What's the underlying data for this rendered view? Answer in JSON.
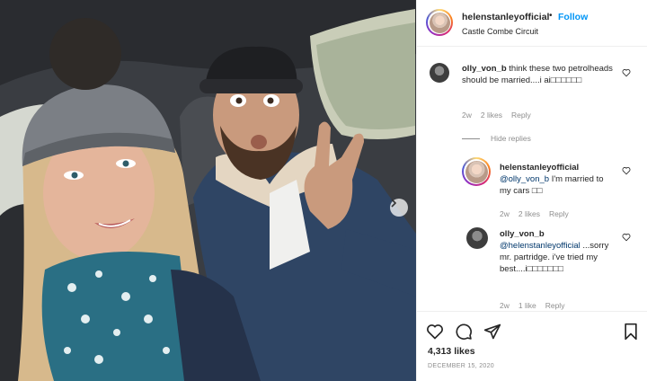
{
  "post": {
    "username": "helenstanleyofficial",
    "separator": "•",
    "follow_label": "Follow",
    "location": "Castle Combe Circuit"
  },
  "comments": [
    {
      "username": "olly_von_b",
      "text": "think these two petrolheads should be married....i ai□□□□□□",
      "time": "2w",
      "likes": "2 likes",
      "reply": "Reply"
    }
  ],
  "hide_replies_label": "Hide replies",
  "replies": [
    {
      "username": "helenstanleyofficial",
      "mention": "@olly_von_b",
      "text": " I'm married to my cars □□",
      "time": "2w",
      "likes": "2 likes",
      "reply": "Reply"
    },
    {
      "username": "olly_von_b",
      "mention": "@helenstanleyofficial",
      "text": " ...sorry mr. partridge. i've tried my best....i□□□□□□□",
      "time": "2w",
      "likes": "1 like",
      "reply": "Reply"
    }
  ],
  "actions": {
    "icons": [
      "heart-icon",
      "comment-icon",
      "share-icon",
      "bookmark-icon"
    ],
    "likes_count": "4,313 likes",
    "date": "DECEMBER 15, 2020"
  },
  "colors": {
    "follow": "#0095f6",
    "muted": "#8e8e8e",
    "mention": "#00376b",
    "text": "#262626"
  }
}
